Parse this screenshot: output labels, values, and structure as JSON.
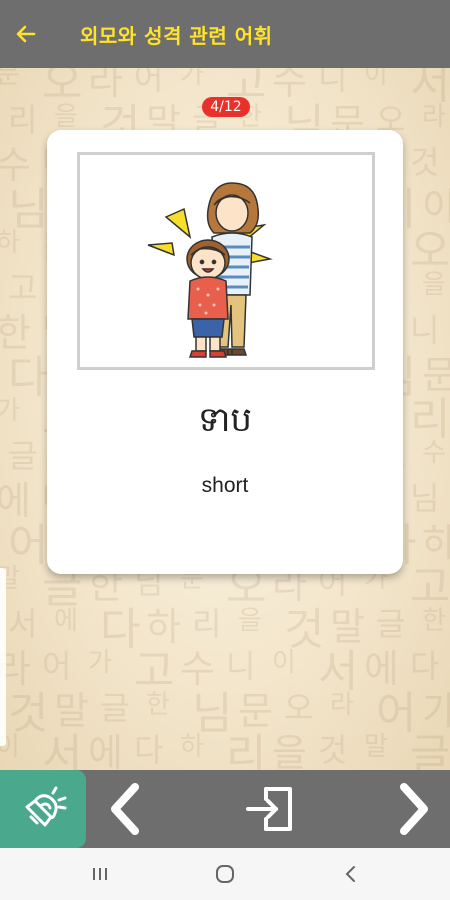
{
  "header": {
    "title": "외모와 성격 관련 어휘"
  },
  "counter": "4/12",
  "card": {
    "word": "ទាប",
    "meaning": "short"
  },
  "background": {
    "glyphs": [
      "문",
      "님",
      "한",
      "글",
      "말",
      "것",
      "을",
      "리",
      "하",
      "다",
      "에",
      "서",
      "이",
      "니",
      "수",
      "고",
      "가",
      "어",
      "라",
      "오"
    ]
  },
  "colors": {
    "header_bg": "#6e6e6e",
    "title": "#ffe32b",
    "counter_bg": "#e8312a",
    "speak_bg": "#4aa98c"
  },
  "icons": {
    "back": "arrow-left-icon",
    "speak": "speaker-icon",
    "prev": "chevron-left-icon",
    "exit": "exit-icon",
    "next": "chevron-right-icon"
  }
}
